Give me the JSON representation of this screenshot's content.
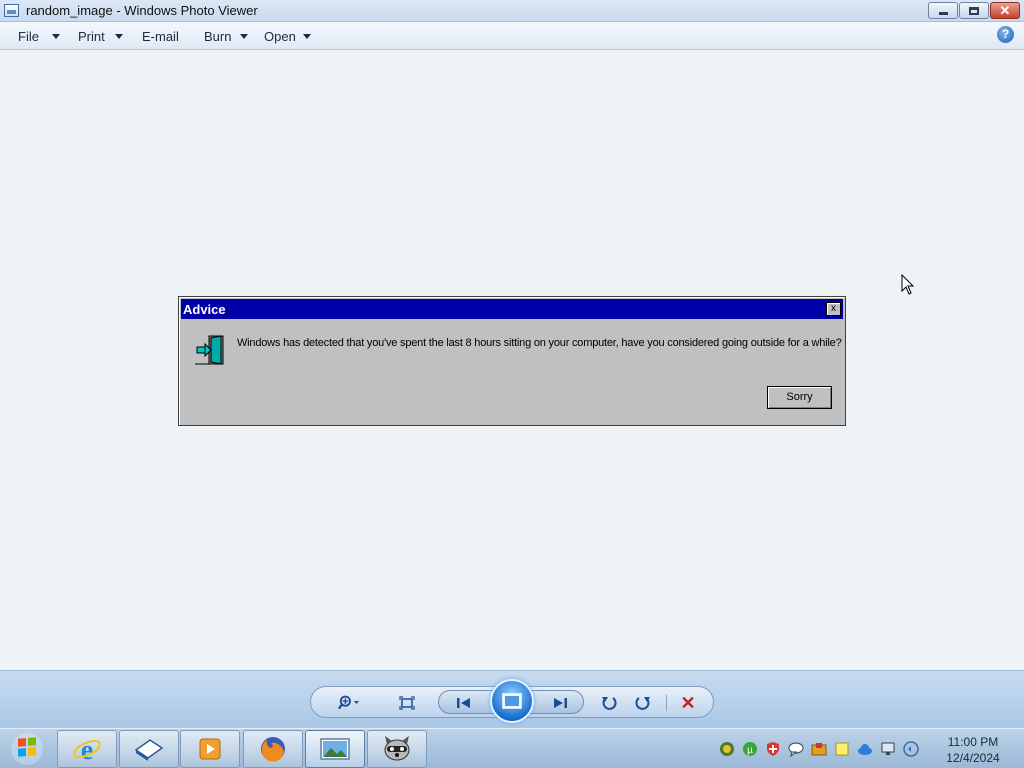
{
  "window": {
    "title": "random_image - Windows Photo Viewer",
    "buttons": {
      "minimize": "minimize-icon",
      "restore": "restore-icon",
      "close": "close-icon"
    }
  },
  "menu": {
    "items": [
      {
        "label": "File",
        "has_dropdown": true
      },
      {
        "label": "Print",
        "has_dropdown": true
      },
      {
        "label": "E-mail",
        "has_dropdown": false
      },
      {
        "label": "Burn",
        "has_dropdown": true
      },
      {
        "label": "Open",
        "has_dropdown": true
      }
    ],
    "help_glyph": "?"
  },
  "dialog": {
    "title": "Advice",
    "close_glyph": "x",
    "message": "Windows has detected that you've spent the last 8 hours sitting on your computer, have you considered going outside for a while?",
    "button_label": "Sorry",
    "icon": "exit-door-icon",
    "title_color": "#0000a8"
  },
  "controls": {
    "icons": [
      "zoom-icon",
      "actual-size-icon",
      "previous-icon",
      "slideshow-icon",
      "next-icon",
      "rotate-counterclockwise-icon",
      "rotate-clockwise-icon",
      "delete-icon"
    ],
    "delete_glyph": "✕"
  },
  "taskbar": {
    "start": "windows-start-icon",
    "pinned": [
      "internet-explorer-icon",
      "desktop-icon",
      "media-player-icon",
      "firefox-icon",
      "photo-viewer-icon",
      "raccoon-app-icon"
    ],
    "active": "photo-viewer-icon",
    "tray": [
      "tray-app-1-icon",
      "utorrent-icon",
      "shield-icon",
      "chat-icon",
      "folder-icon",
      "notes-icon",
      "cloud-icon",
      "network-icon",
      "volume-icon"
    ],
    "time": "11:00 PM",
    "date": "12/4/2024"
  }
}
